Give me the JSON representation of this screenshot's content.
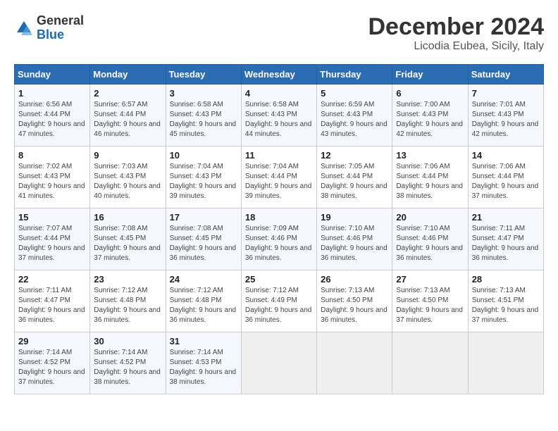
{
  "header": {
    "logo_general": "General",
    "logo_blue": "Blue",
    "title": "December 2024",
    "subtitle": "Licodia Eubea, Sicily, Italy"
  },
  "days_of_week": [
    "Sunday",
    "Monday",
    "Tuesday",
    "Wednesday",
    "Thursday",
    "Friday",
    "Saturday"
  ],
  "weeks": [
    [
      {
        "day": 1,
        "sunrise": "6:56 AM",
        "sunset": "4:44 PM",
        "daylight": "9 hours and 47 minutes."
      },
      {
        "day": 2,
        "sunrise": "6:57 AM",
        "sunset": "4:44 PM",
        "daylight": "9 hours and 46 minutes."
      },
      {
        "day": 3,
        "sunrise": "6:58 AM",
        "sunset": "4:43 PM",
        "daylight": "9 hours and 45 minutes."
      },
      {
        "day": 4,
        "sunrise": "6:58 AM",
        "sunset": "4:43 PM",
        "daylight": "9 hours and 44 minutes."
      },
      {
        "day": 5,
        "sunrise": "6:59 AM",
        "sunset": "4:43 PM",
        "daylight": "9 hours and 43 minutes."
      },
      {
        "day": 6,
        "sunrise": "7:00 AM",
        "sunset": "4:43 PM",
        "daylight": "9 hours and 42 minutes."
      },
      {
        "day": 7,
        "sunrise": "7:01 AM",
        "sunset": "4:43 PM",
        "daylight": "9 hours and 42 minutes."
      }
    ],
    [
      {
        "day": 8,
        "sunrise": "7:02 AM",
        "sunset": "4:43 PM",
        "daylight": "9 hours and 41 minutes."
      },
      {
        "day": 9,
        "sunrise": "7:03 AM",
        "sunset": "4:43 PM",
        "daylight": "9 hours and 40 minutes."
      },
      {
        "day": 10,
        "sunrise": "7:04 AM",
        "sunset": "4:43 PM",
        "daylight": "9 hours and 39 minutes."
      },
      {
        "day": 11,
        "sunrise": "7:04 AM",
        "sunset": "4:44 PM",
        "daylight": "9 hours and 39 minutes."
      },
      {
        "day": 12,
        "sunrise": "7:05 AM",
        "sunset": "4:44 PM",
        "daylight": "9 hours and 38 minutes."
      },
      {
        "day": 13,
        "sunrise": "7:06 AM",
        "sunset": "4:44 PM",
        "daylight": "9 hours and 38 minutes."
      },
      {
        "day": 14,
        "sunrise": "7:06 AM",
        "sunset": "4:44 PM",
        "daylight": "9 hours and 37 minutes."
      }
    ],
    [
      {
        "day": 15,
        "sunrise": "7:07 AM",
        "sunset": "4:44 PM",
        "daylight": "9 hours and 37 minutes."
      },
      {
        "day": 16,
        "sunrise": "7:08 AM",
        "sunset": "4:45 PM",
        "daylight": "9 hours and 37 minutes."
      },
      {
        "day": 17,
        "sunrise": "7:08 AM",
        "sunset": "4:45 PM",
        "daylight": "9 hours and 36 minutes."
      },
      {
        "day": 18,
        "sunrise": "7:09 AM",
        "sunset": "4:46 PM",
        "daylight": "9 hours and 36 minutes."
      },
      {
        "day": 19,
        "sunrise": "7:10 AM",
        "sunset": "4:46 PM",
        "daylight": "9 hours and 36 minutes."
      },
      {
        "day": 20,
        "sunrise": "7:10 AM",
        "sunset": "4:46 PM",
        "daylight": "9 hours and 36 minutes."
      },
      {
        "day": 21,
        "sunrise": "7:11 AM",
        "sunset": "4:47 PM",
        "daylight": "9 hours and 36 minutes."
      }
    ],
    [
      {
        "day": 22,
        "sunrise": "7:11 AM",
        "sunset": "4:47 PM",
        "daylight": "9 hours and 36 minutes."
      },
      {
        "day": 23,
        "sunrise": "7:12 AM",
        "sunset": "4:48 PM",
        "daylight": "9 hours and 36 minutes."
      },
      {
        "day": 24,
        "sunrise": "7:12 AM",
        "sunset": "4:48 PM",
        "daylight": "9 hours and 36 minutes."
      },
      {
        "day": 25,
        "sunrise": "7:12 AM",
        "sunset": "4:49 PM",
        "daylight": "9 hours and 36 minutes."
      },
      {
        "day": 26,
        "sunrise": "7:13 AM",
        "sunset": "4:50 PM",
        "daylight": "9 hours and 36 minutes."
      },
      {
        "day": 27,
        "sunrise": "7:13 AM",
        "sunset": "4:50 PM",
        "daylight": "9 hours and 37 minutes."
      },
      {
        "day": 28,
        "sunrise": "7:13 AM",
        "sunset": "4:51 PM",
        "daylight": "9 hours and 37 minutes."
      }
    ],
    [
      {
        "day": 29,
        "sunrise": "7:14 AM",
        "sunset": "4:52 PM",
        "daylight": "9 hours and 37 minutes."
      },
      {
        "day": 30,
        "sunrise": "7:14 AM",
        "sunset": "4:52 PM",
        "daylight": "9 hours and 38 minutes."
      },
      {
        "day": 31,
        "sunrise": "7:14 AM",
        "sunset": "4:53 PM",
        "daylight": "9 hours and 38 minutes."
      },
      null,
      null,
      null,
      null
    ]
  ]
}
